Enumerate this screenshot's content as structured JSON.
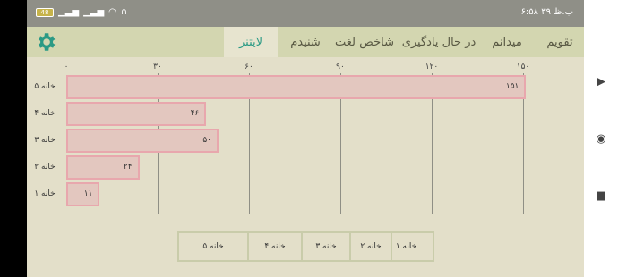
{
  "status_bar": {
    "battery": "48",
    "time": "۶:۵۸ ب.ظ ۳۹"
  },
  "tabs": [
    {
      "label": "تقویم"
    },
    {
      "label": "میدانم"
    },
    {
      "label": "در حال یادگیری"
    },
    {
      "label": "شاخص لغت"
    },
    {
      "label": "شنیدم"
    },
    {
      "label": "لایتنر"
    }
  ],
  "active_tab": "لایتنر",
  "icons": {
    "settings": "gear-icon",
    "accent": "#2b9a85"
  },
  "chart_data": {
    "type": "bar",
    "orientation": "horizontal",
    "categories": [
      "خانه ۵",
      "خانه ۴",
      "خانه ۳",
      "خانه ۲",
      "خانه ۱"
    ],
    "values": [
      151,
      46,
      50,
      24,
      11
    ],
    "value_labels": [
      "۱۵۱",
      "۴۶",
      "۵۰",
      "۲۴",
      "۱۱"
    ],
    "x_ticks": [
      "۰",
      "۳۰",
      "۶۰",
      "۹۰",
      "۱۲۰",
      "۱۵۰"
    ],
    "xlim": [
      0,
      150
    ],
    "grid": true,
    "bar_color": "#e3c7bf",
    "bar_border": "#e8a7ad"
  },
  "legend": {
    "items": [
      "خانه ۵",
      "خانه ۴",
      "خانه ۳",
      "خانه ۲",
      "خانه ۱"
    ]
  }
}
